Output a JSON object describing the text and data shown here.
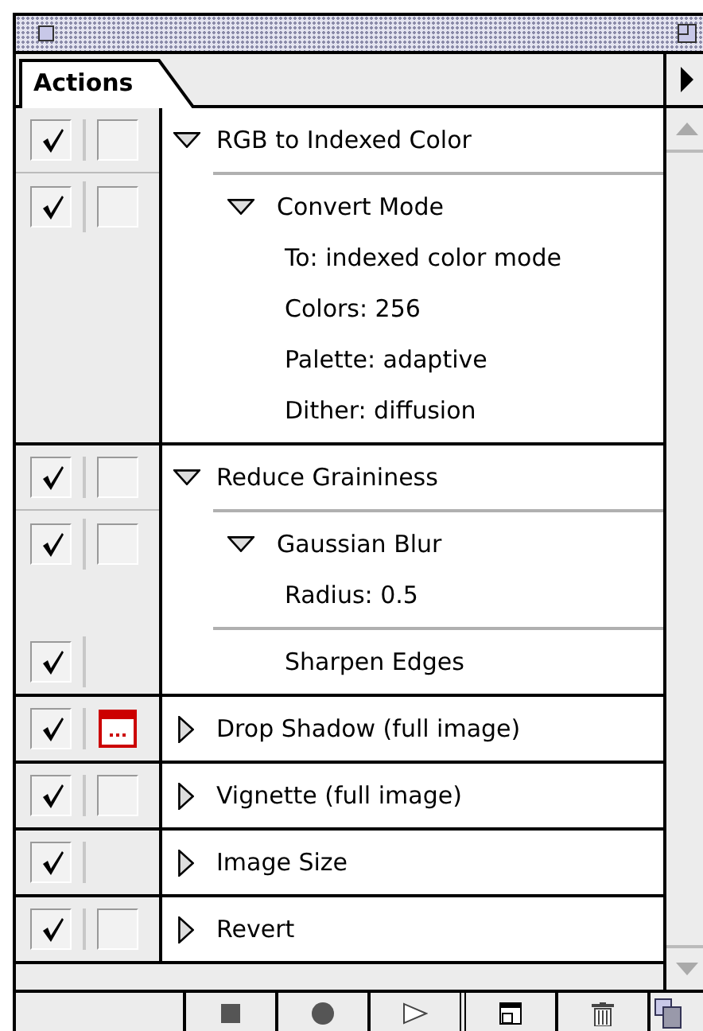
{
  "window": {
    "tab": "Actions"
  },
  "actions": [
    {
      "label": "RGB to Indexed Color",
      "checked": true,
      "dialog": false,
      "expanded": true,
      "commands": [
        {
          "label": "Convert Mode",
          "checked": true,
          "dialog": false,
          "expanded": true,
          "parameters": [
            "To: indexed color mode",
            "Colors: 256",
            "Palette: adaptive",
            "Dither: diffusion"
          ]
        }
      ]
    },
    {
      "label": "Reduce Graininess",
      "checked": true,
      "dialog": false,
      "expanded": true,
      "commands": [
        {
          "label": "Gaussian Blur",
          "checked": true,
          "dialog": false,
          "expanded": true,
          "parameters": [
            "Radius: 0.5"
          ]
        },
        {
          "label": "Sharpen Edges",
          "checked": true
        }
      ]
    },
    {
      "label": "Drop Shadow (full image)",
      "checked": true,
      "dialog": true,
      "expanded": false
    },
    {
      "label": "Vignette (full image)",
      "checked": true,
      "dialog": false,
      "expanded": false
    },
    {
      "label": "Image Size",
      "checked": true,
      "expanded": false
    },
    {
      "label": "Revert",
      "checked": true,
      "dialog": false,
      "expanded": false
    }
  ]
}
